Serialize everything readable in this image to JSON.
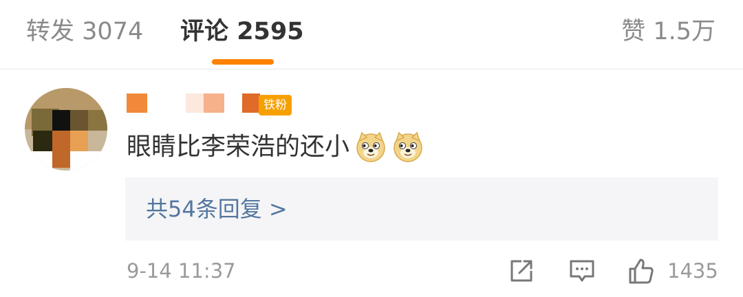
{
  "tabs": {
    "repost": {
      "label": "转发",
      "count": "3074"
    },
    "comments": {
      "label": "评论",
      "count": "2595"
    },
    "likes": {
      "label": "赞",
      "count": "1.5万"
    }
  },
  "comment": {
    "badge": "铁粉",
    "text": "眼睛比李荣浩的还小",
    "emojis": [
      "doge-emoji",
      "doge-emoji"
    ],
    "replies_label": "共54条回复 >",
    "time": "9-14 11:37",
    "like_count": "1435"
  },
  "colors": {
    "accent": "#ff8200",
    "link": "#53769f",
    "muted": "#9a9a9a",
    "badge": "#f6a000",
    "reply_bg": "#f5f5f7"
  }
}
